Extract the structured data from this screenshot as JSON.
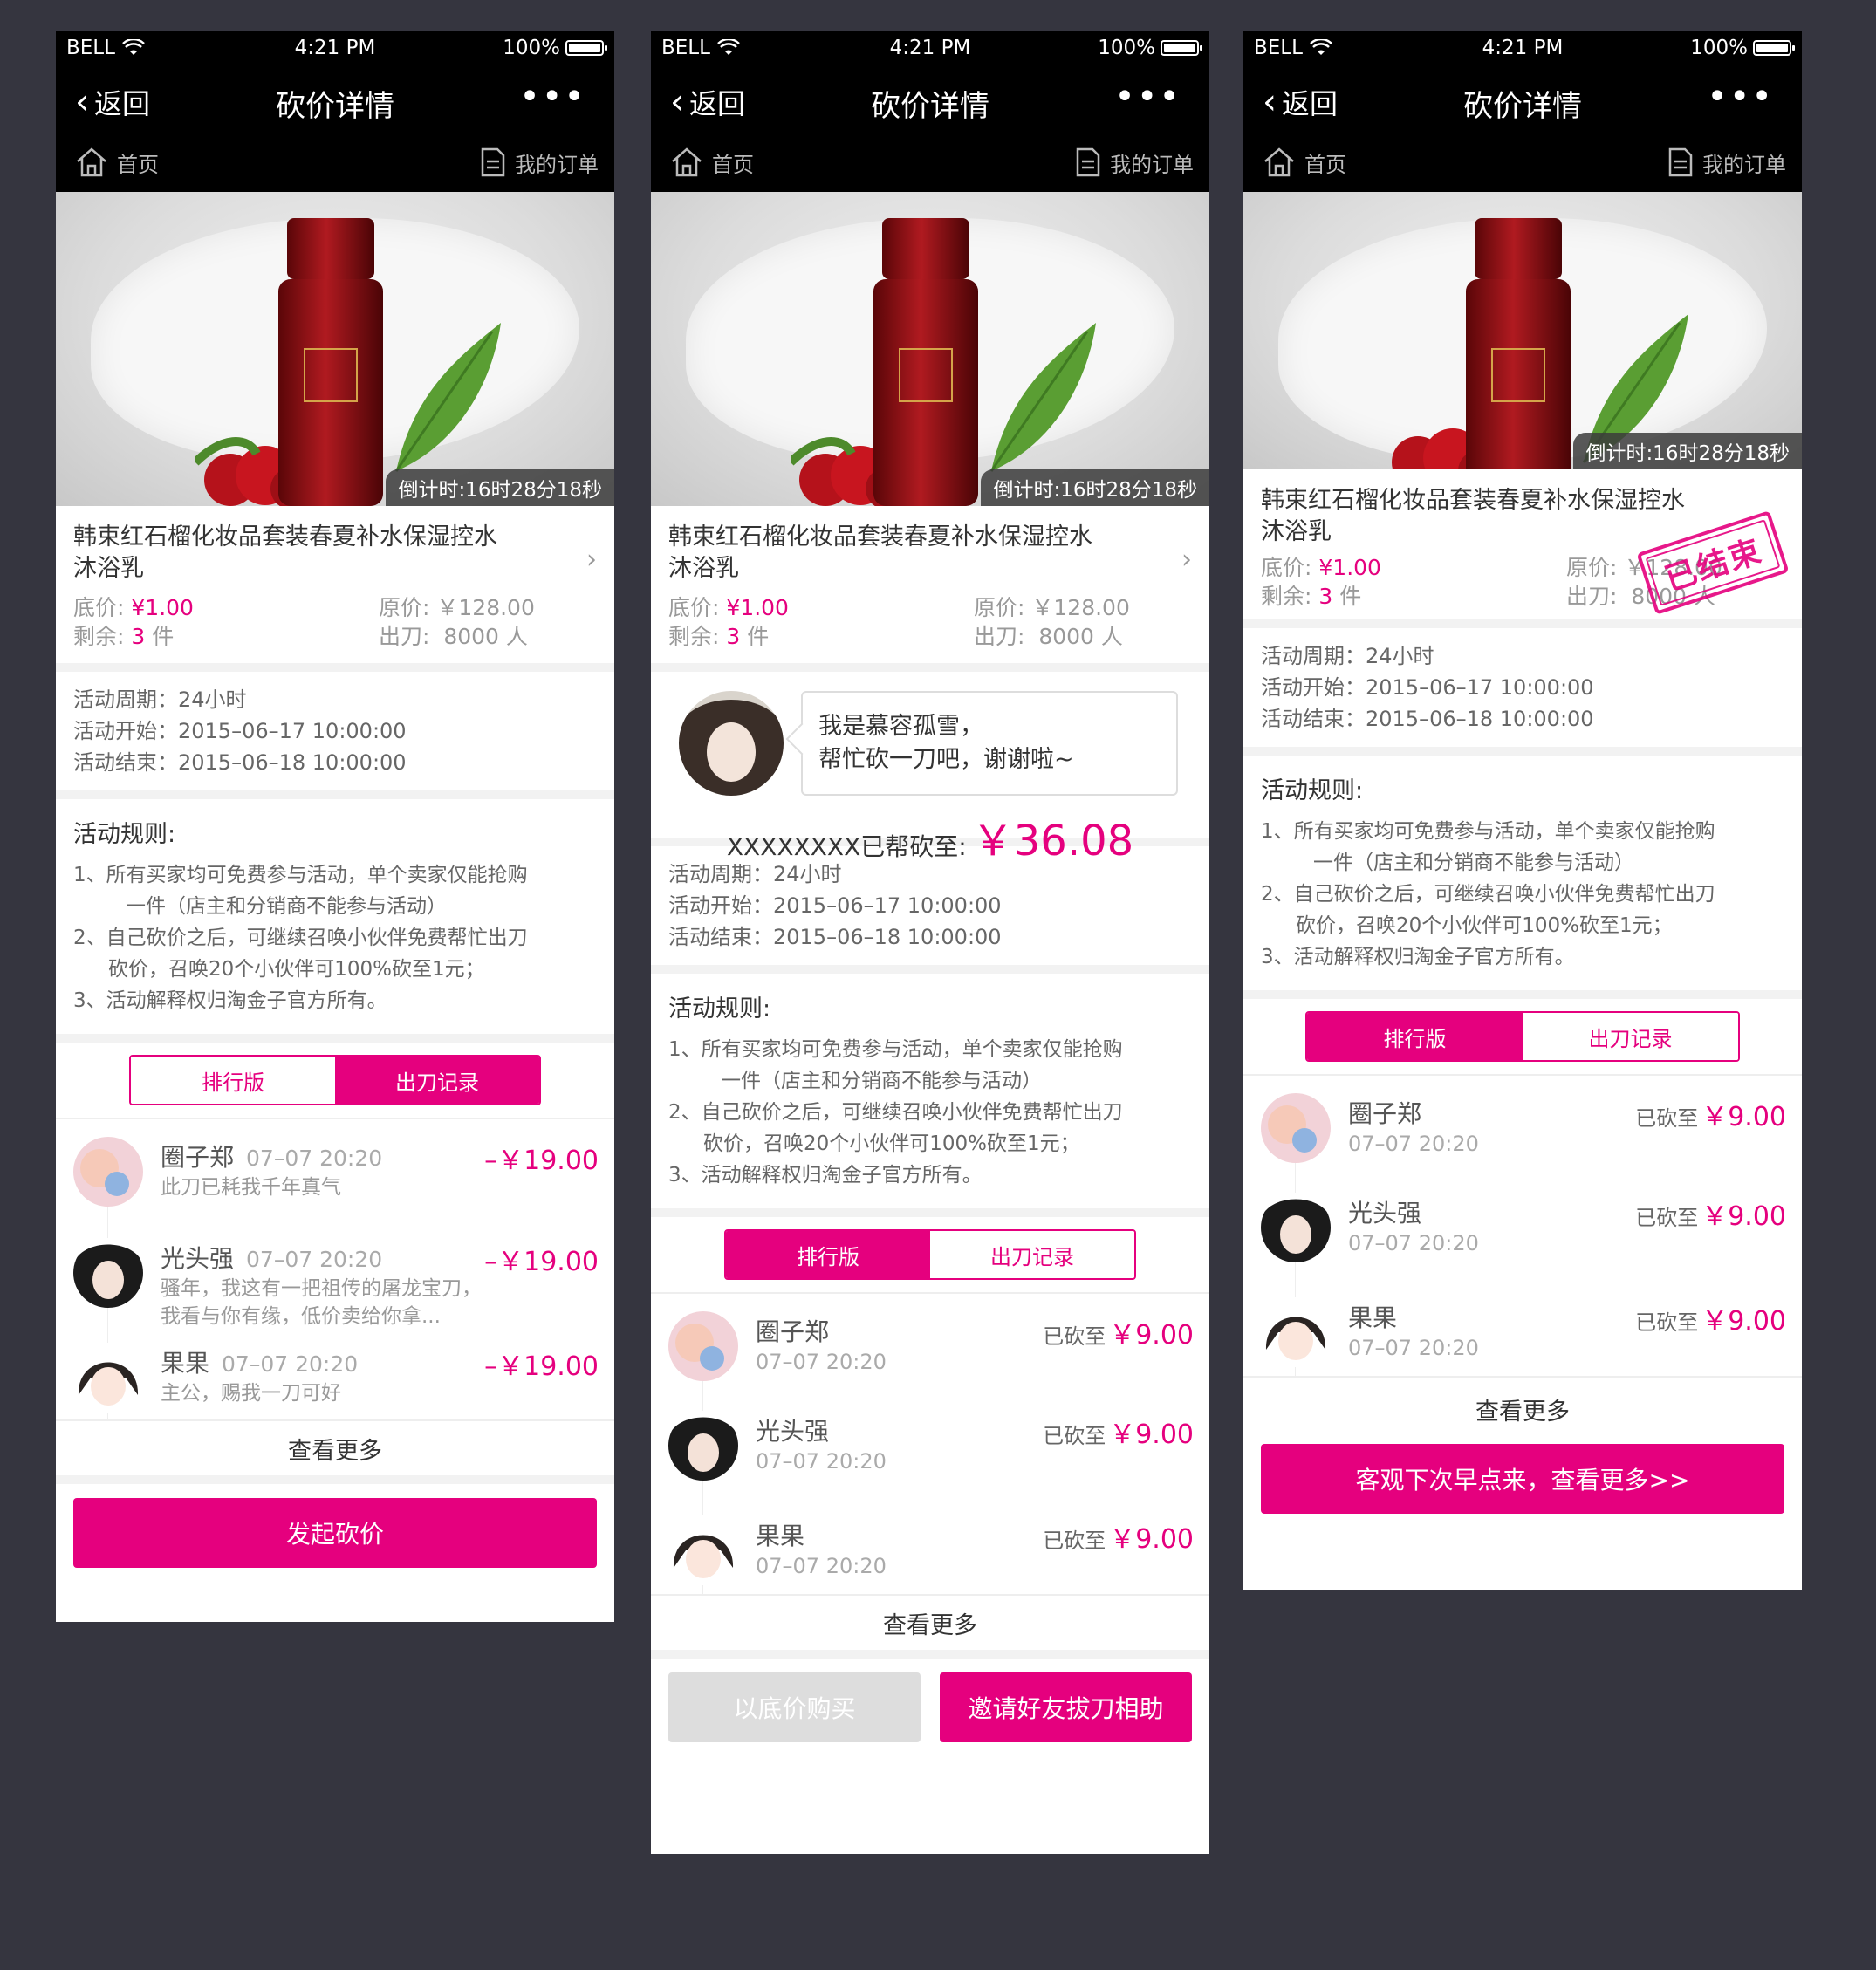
{
  "status": {
    "carrier": "BELL",
    "time": "4:21 PM",
    "battery": "100%"
  },
  "nav": {
    "back": "返回",
    "title": "砍价详情",
    "more": "•••",
    "home": "首页",
    "orders": "我的订单"
  },
  "product": {
    "countdown": "倒计时:16时28分18秒",
    "name_line1": "韩束红石榴化妆品套装春夏补水保湿控水",
    "name_line2": "沐浴乳",
    "base_label": "底价:",
    "base_price": "¥1.00",
    "orig_label": "原价:",
    "orig_price": "￥128.00",
    "remain_label": "剩余:",
    "remain_count": "3",
    "remain_unit": "件",
    "cut_label": "出刀:",
    "cut_count": "8000 人"
  },
  "period": {
    "cycle": "活动周期：24小时",
    "start": "活动开始：2015–06–17 10:00:00",
    "end": "活动结束：2015–06–18 10:00:00"
  },
  "rules": {
    "title": "活动规则:",
    "l1": "1、所有买家均可免费参与活动，单个卖家仅能抢购",
    "l1b": "一件（店主和分销商不能参与活动）",
    "l2": "2、自己砍价之后，可继续召唤小伙伴免费帮忙出刀",
    "l2b": "砍价，召唤20个小伙伴可100%砍至1元；",
    "l3": "3、活动解释权归淘金子官方所有。"
  },
  "tabs": {
    "rank": "排行版",
    "records": "出刀记录"
  },
  "records_list": [
    {
      "name": "圈子郑",
      "time": "07–07 20:20",
      "amount": "–￥19.00",
      "msg": "此刀已耗我千年真气"
    },
    {
      "name": "光头强",
      "time": "07–07 20:20",
      "amount": "–￥19.00",
      "msg": "骚年，我这有一把祖传的屠龙宝刀，我看与你有缘，低价卖给你拿..."
    },
    {
      "name": "果果",
      "time": "07–07 20:20",
      "amount": "–￥19.00",
      "msg": "主公，赐我一刀可好"
    }
  ],
  "rank_list": [
    {
      "name": "圈子郑",
      "time": "07–07 20:20",
      "label": "已砍至",
      "amount": "￥9.00"
    },
    {
      "name": "光头强",
      "time": "07–07 20:20",
      "label": "已砍至",
      "amount": "￥9.00"
    },
    {
      "name": "果果",
      "time": "07–07 20:20",
      "label": "已砍至",
      "amount": "￥9.00"
    }
  ],
  "more": "查看更多",
  "helper": {
    "bubble1": "我是慕容孤雪，",
    "bubble2": "帮忙砍一刀吧，谢谢啦~",
    "cut_text": "XXXXXXXX已帮砍至:",
    "cut_amount": "￥36.08"
  },
  "buttons": {
    "start": "发起砍价",
    "buy_base": "以底价购买",
    "invite": "邀请好友拔刀相助",
    "next_time": "客观下次早点来，查看更多>>"
  },
  "stamp": "已结束",
  "colors": {
    "accent": "#e5007e",
    "background": "#35353f"
  }
}
